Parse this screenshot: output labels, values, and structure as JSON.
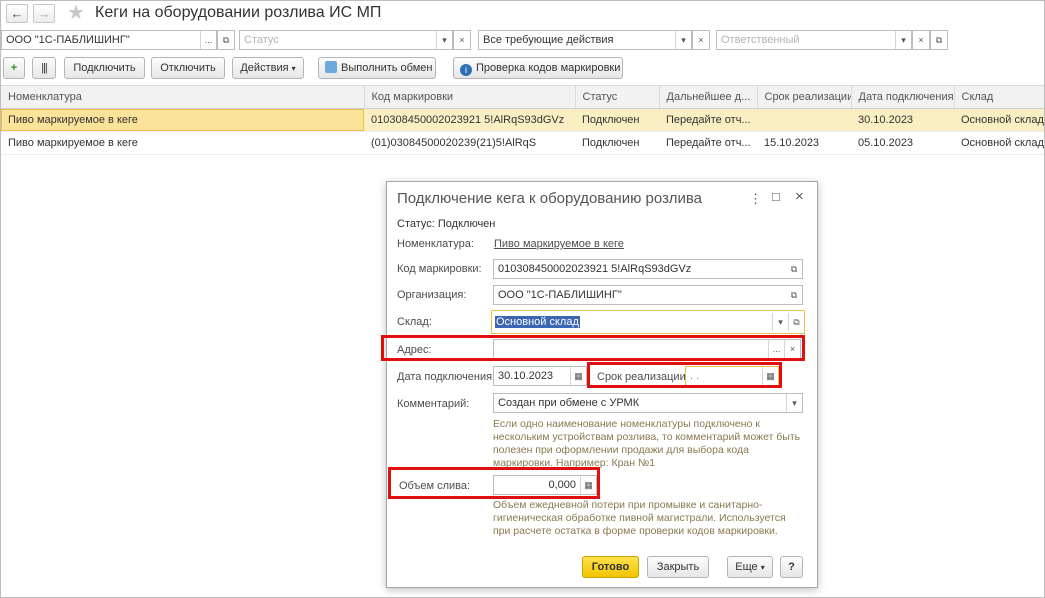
{
  "window": {
    "title": "Кеги на оборудовании розлива ИС МП"
  },
  "filters": {
    "organization": "ООО \"1С-ПАБЛИШИНГ\"",
    "status_placeholder": "Статус",
    "actions_value": "Все требующие действия",
    "responsible_placeholder": "Ответственный"
  },
  "toolbar": {
    "connect": "Подключить",
    "disconnect": "Отключить",
    "actions": "Действия",
    "exchange": "Выполнить обмен",
    "check_codes": "Проверка кодов маркировки"
  },
  "table": {
    "columns": [
      "Номенклатура",
      "Код маркировки",
      "Статус",
      "Дальнейшее д...",
      "Срок реализации",
      "Дата подключения",
      "Склад"
    ],
    "rows": [
      [
        "Пиво маркируемое в кеге",
        "010308450002023921 5!AlRqS93dGVz",
        "Подключен",
        "Передайте отч...",
        "",
        "30.10.2023",
        "Основной склад"
      ],
      [
        "Пиво маркируемое в кеге",
        "(01)03084500020239(21)5!AlRqS",
        "Подключен",
        "Передайте отч...",
        "15.10.2023",
        "05.10.2023",
        "Основной склад"
      ]
    ]
  },
  "dialog": {
    "title": "Подключение кега к оборудованию розлива",
    "status_text": "Статус: Подключен",
    "nomenclature_label": "Номенклатура:",
    "nomenclature_value": "Пиво маркируемое в кеге",
    "code_label": "Код маркировки:",
    "code_value": "010308450002023921 5!AlRqS93dGVz",
    "org_label": "Организация:",
    "org_value": "ООО \"1С-ПАБЛИШИНГ\"",
    "warehouse_label": "Склад:",
    "warehouse_value": "Основной склад",
    "address_label": "Адрес:",
    "address_value": "",
    "date_label": "Дата подключения:",
    "date_value": "30.10.2023",
    "expiry_label": "Срок реализации:",
    "expiry_value": ".  .",
    "comment_label": "Комментарий:",
    "comment_value": "Создан при обмене с УРМК",
    "comment_hint": "Если одно наименование номенклатуры подключено к нескольким устройствам розлива, то комментарий может быть полезен при оформлении продажи для выбора кода маркировки. Например: Кран №1",
    "volume_label": "Объем слива:",
    "volume_value": "0,000",
    "volume_hint": "Объем ежедневной потери при промывке и санитарно-гигиеническая обработке пивной магистрали. Используется при расчете остатка в форме проверки кодов маркировки.",
    "btn_done": "Готово",
    "btn_close": "Закрыть",
    "btn_more": "Еще",
    "btn_help": "?"
  }
}
